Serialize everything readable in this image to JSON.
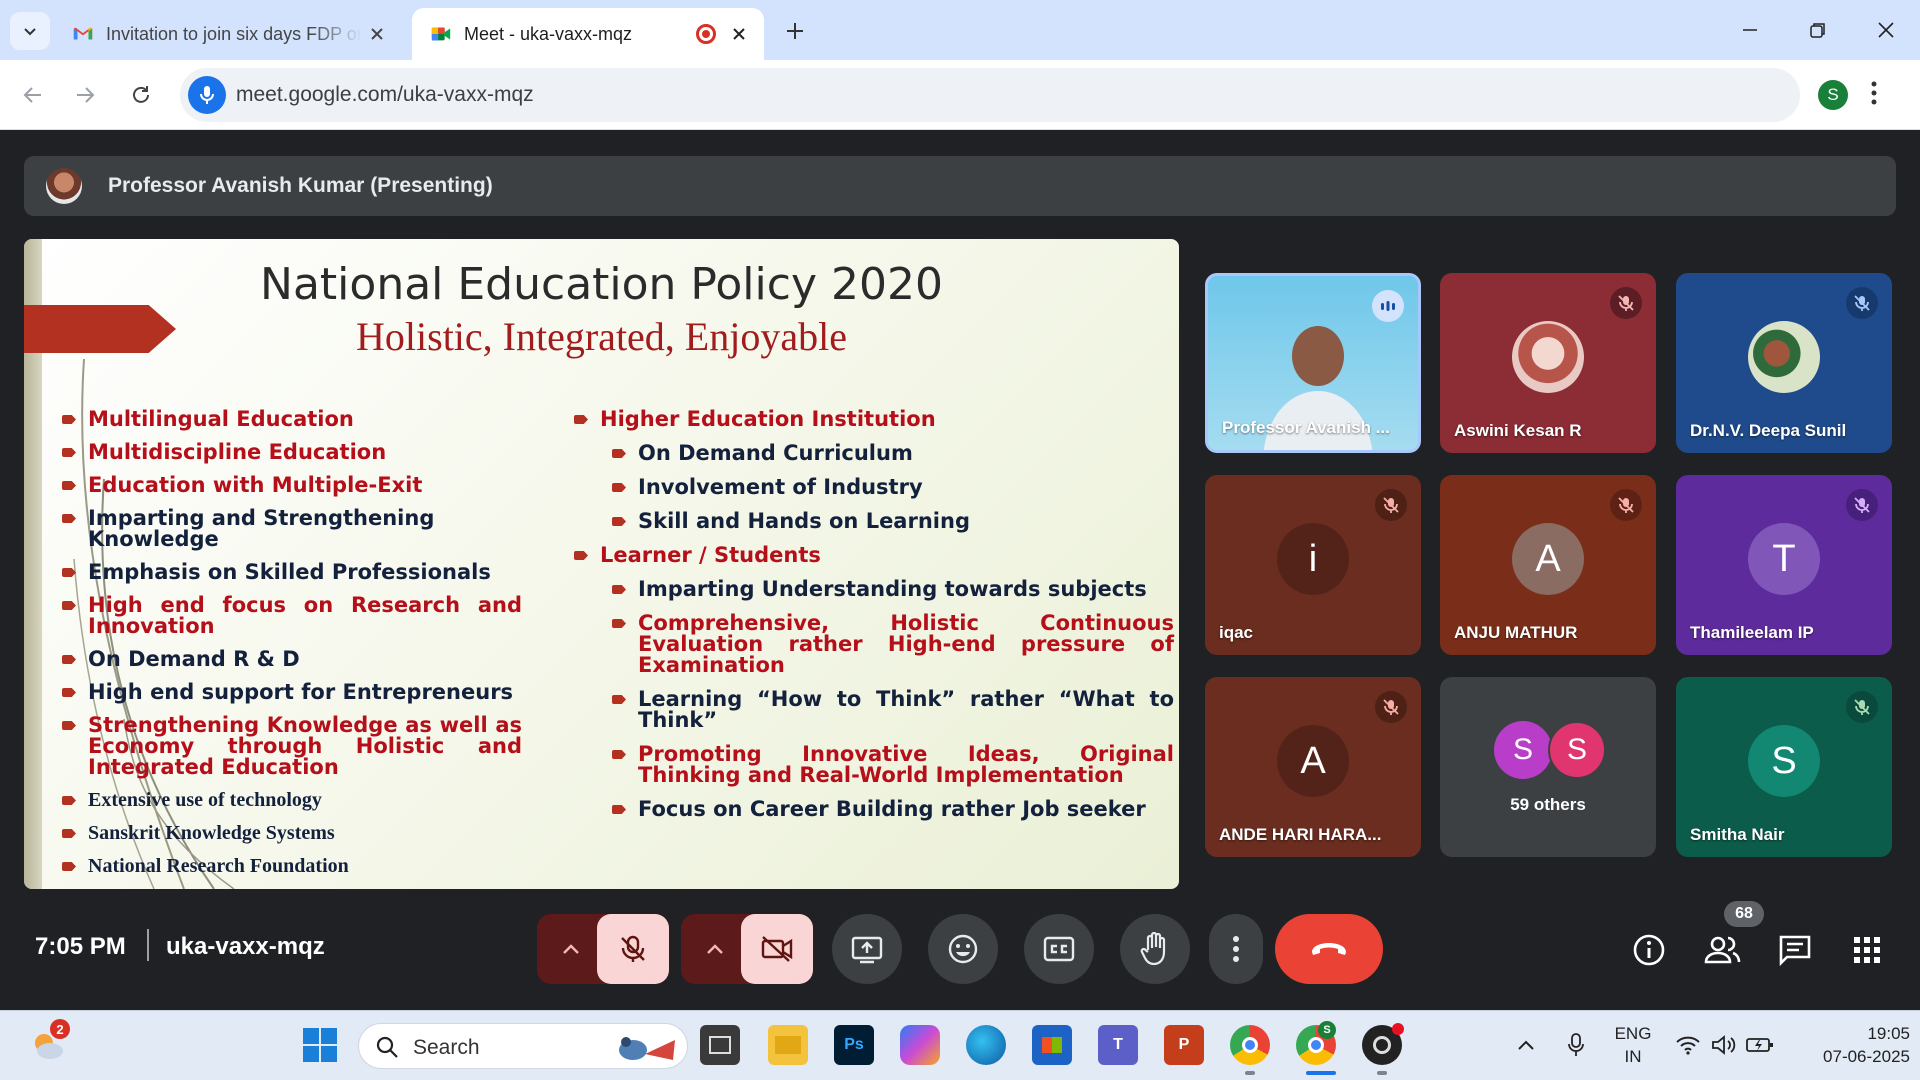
{
  "browser": {
    "tabs": [
      {
        "title": "Invitation to join six days FDP on",
        "active": false
      },
      {
        "title": "Meet - uka-vaxx-mqz",
        "active": true,
        "recording": true
      }
    ],
    "url": "meet.google.com/uka-vaxx-mqz",
    "profile_initial": "S"
  },
  "meet": {
    "presenter_banner": "Professor Avanish Kumar (Presenting)",
    "slide": {
      "title": "National Education Policy 2020",
      "subtitle": "Holistic, Integrated, Enjoyable",
      "left": [
        {
          "text": "Multilingual Education",
          "color": "red"
        },
        {
          "text": "Multidiscipline Education",
          "color": "red"
        },
        {
          "text": "Education with Multiple-Exit",
          "color": "red"
        },
        {
          "text": "Imparting and Strengthening Knowledge",
          "color": "navy"
        },
        {
          "text": "Emphasis on Skilled Professionals",
          "color": "navy"
        },
        {
          "text": "High end focus on Research and Innovation",
          "color": "red"
        },
        {
          "text": "On Demand R & D",
          "color": "navy"
        },
        {
          "text": "High end support for Entrepreneurs",
          "color": "navy"
        },
        {
          "text": "Strengthening Knowledge as well as Economy through Holistic and Integrated Education",
          "color": "red"
        },
        {
          "text": "Extensive use of technology",
          "color": "navy"
        },
        {
          "text": "Sanskrit Knowledge Systems",
          "color": "navy"
        },
        {
          "text": "National Research Foundation",
          "color": "navy"
        }
      ],
      "right_heading_1": "Higher Education Institution",
      "right_items_1": [
        "On Demand Curriculum",
        "Involvement of Industry",
        "Skill and Hands on Learning"
      ],
      "right_heading_2": "Learner / Students",
      "right_items_2": [
        {
          "text": "Imparting Understanding towards subjects",
          "color": "navy"
        },
        {
          "text": "Comprehensive, Holistic Continuous Evaluation rather High-end pressure of Examination",
          "color": "red"
        },
        {
          "text": "Learning “How to Think” rather “What to Think”",
          "color": "navy"
        },
        {
          "text": "Promoting Innovative Ideas, Original Thinking and Real-World Implementation",
          "color": "red"
        },
        {
          "text": "Focus on Career Building rather Job seeker",
          "color": "navy"
        }
      ]
    },
    "participants": [
      {
        "name": "Professor Avanish ...",
        "initial": "",
        "muted": false
      },
      {
        "name": "Aswini Kesan R",
        "initial": "",
        "muted": true
      },
      {
        "name": "Dr.N.V. Deepa Sunil",
        "initial": "",
        "muted": true
      },
      {
        "name": "iqac",
        "initial": "i",
        "muted": true
      },
      {
        "name": "ANJU MATHUR",
        "initial": "A",
        "muted": true
      },
      {
        "name": "Thamileelam IP",
        "initial": "T",
        "muted": true
      },
      {
        "name": "ANDE HARI HARA...",
        "initial": "A",
        "muted": true
      },
      {
        "name": "59 others",
        "initial": "S",
        "muted": false
      },
      {
        "name": "Smitha Nair",
        "initial": "S",
        "muted": true
      }
    ],
    "others_initials": [
      "S",
      "S"
    ],
    "time": "7:05 PM",
    "meeting_code": "uka-vaxx-mqz",
    "participant_count": "68"
  },
  "taskbar": {
    "search_label": "Search",
    "notif_count": "2",
    "chrome_badge": "S",
    "lang_line1": "ENG",
    "lang_line2": "IN",
    "time": "19:05",
    "date": "07-06-2025"
  },
  "colors": {
    "red": "#b50f1a",
    "navy": "#14213d",
    "end_call": "#ea4335"
  }
}
